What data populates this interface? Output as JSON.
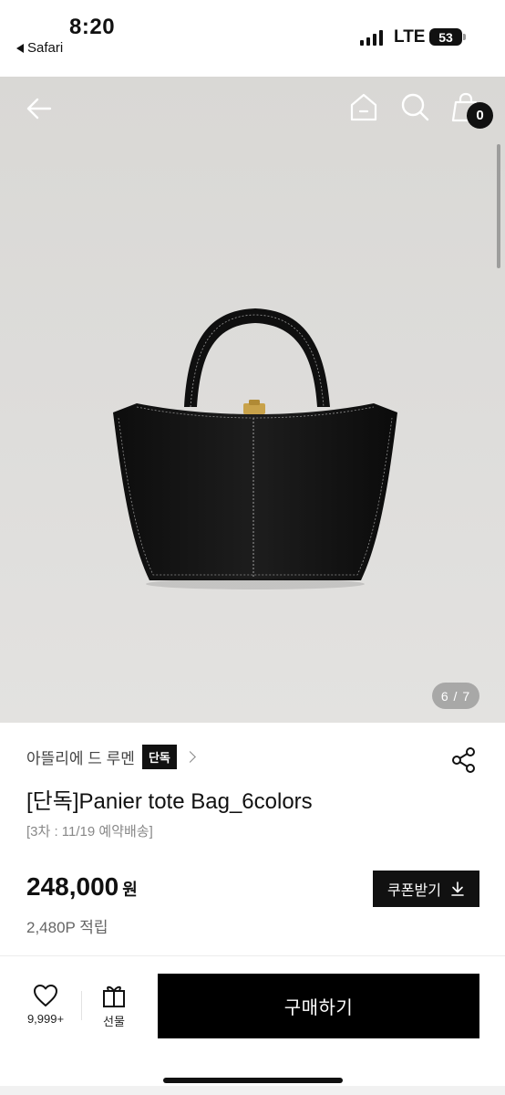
{
  "status_bar": {
    "time": "8:20",
    "back_app": "Safari",
    "network": "LTE",
    "battery": "53"
  },
  "hero": {
    "page_indicator": "6 / 7",
    "cart_count": "0"
  },
  "product": {
    "brand": "아뜰리에 드 루멘",
    "brand_tag": "단독",
    "title": "[단독]Panier tote Bag_6colors",
    "shipping_note": "[3차 : 11/19 예약배송]",
    "price": "248,000",
    "price_unit": "원",
    "points": "2,480P 적립",
    "coupon_label": "쿠폰받기"
  },
  "bottom_bar": {
    "like_count": "9,999+",
    "gift_label": "선물",
    "buy_label": "구매하기"
  },
  "icons": {
    "back": "arrow-left-icon",
    "home": "home-icon",
    "search": "search-icon",
    "cart": "shopping-bag-icon",
    "share": "share-icon",
    "download": "download-icon",
    "like": "heart-icon",
    "gift": "gift-icon"
  }
}
